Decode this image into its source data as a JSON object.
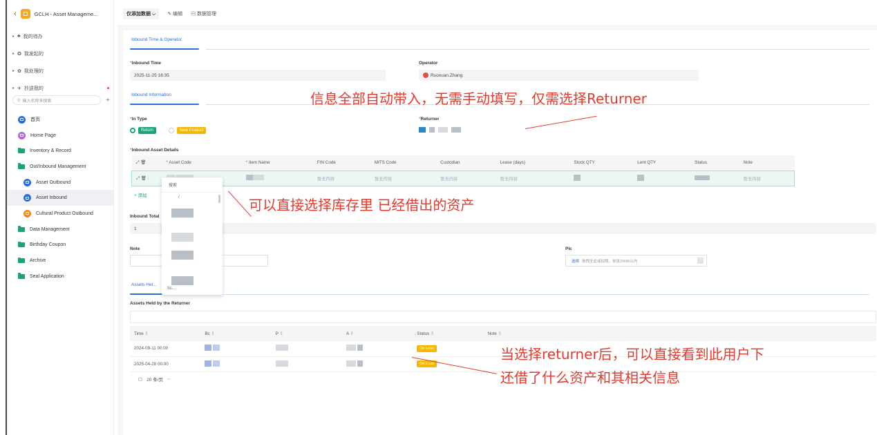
{
  "app": {
    "title": "GCLH - Asset Manageme..."
  },
  "nav_top": [
    {
      "label": "我的待办",
      "icon": "bell-icon",
      "glyph": "♣"
    },
    {
      "label": "我发起的",
      "icon": "gear-icon",
      "glyph": "✪"
    },
    {
      "label": "我处理的",
      "icon": "handle-icon",
      "glyph": "✿"
    },
    {
      "label": "抄送我的",
      "icon": "send-icon",
      "glyph": "✈"
    }
  ],
  "search": {
    "placeholder": "输入名称来搜索"
  },
  "menu": [
    {
      "label": "首页",
      "type": "home",
      "sub": false,
      "color": "#2b6cd9"
    },
    {
      "label": "Home Page",
      "type": "circle",
      "sub": false,
      "color": "#b36ad7"
    },
    {
      "label": "Inventory & Record",
      "type": "folder",
      "sub": false
    },
    {
      "label": "Out/Inbound Management",
      "type": "folder",
      "sub": false
    },
    {
      "label": "Asset Outbound",
      "type": "circle",
      "sub": true,
      "color": "#2b6cd9"
    },
    {
      "label": "Asset Inbound",
      "type": "circle",
      "sub": true,
      "color": "#2b6cd9",
      "active": true
    },
    {
      "label": "Cultural Product Outbound",
      "type": "circle",
      "sub": true,
      "color": "#f08a24"
    },
    {
      "label": "Data Management",
      "type": "folder",
      "sub": false
    },
    {
      "label": "Birthday Coupon",
      "type": "folder",
      "sub": false
    },
    {
      "label": "Archive",
      "type": "folder",
      "sub": false
    },
    {
      "label": "Seal Application",
      "type": "folder",
      "sub": false
    }
  ],
  "topbar": {
    "view": "仅添加数据",
    "edit": "编辑",
    "data_manage": "数据管理"
  },
  "sections": {
    "time_operator": "Inbound Time & Operator",
    "information": "Inbound Information",
    "assets_held_tab": "Assets Hel..."
  },
  "fields": {
    "inbound_time_label": "Inbound Time",
    "inbound_time_value": "2025-11-25 16:35",
    "operator_label": "Operator",
    "operator_value": "Ruoxuan.Zhang",
    "in_type_label": "In Type",
    "in_type_options": [
      "Return",
      "New Product"
    ],
    "returner_label": "Returner",
    "details_label": "Inbound Asset Details",
    "add_label": "+ 添加",
    "inbound_total_label": "Inbound Total",
    "inbound_total_value": "1",
    "note_label": "Note",
    "pic_label": "Pic",
    "pic_select": "选择",
    "pic_hint": "拖拽至此或拍照，单张20MB以内",
    "held_label": "Assets Held by the Returner"
  },
  "details_columns": [
    "Asset Code",
    "Item Name",
    "FIN Code",
    "MITS Code",
    "Custodian",
    "Lease (days)",
    "Stock QTY",
    "Lent QTY",
    "Status",
    "Note"
  ],
  "details_placeholder": "暂无内容",
  "dropdown": {
    "search": "搜索",
    "first": "/",
    "footer": "Sc..."
  },
  "held_columns": [
    "Time",
    "Bc",
    "P",
    "A",
    "Status",
    "Note"
  ],
  "held_rows": [
    {
      "time": "2024-09-11 00:00",
      "status": "On Loan"
    },
    {
      "time": "2025-04-28 00:00",
      "status": "On Loan"
    }
  ],
  "pager": {
    "page_size": "20 条/页"
  },
  "annotations": {
    "a1": "信息全部自动带入，无需手动填写，仅需选择Returner",
    "a2": "可以直接选择库存里 已经借出的资产",
    "a3_line1": "当选择returner后，可以直接看到此用户下",
    "a3_line2": "还借了什么资产和其相关信息"
  },
  "colors": {
    "accent": "#2b6cd9",
    "green": "#1aa37a",
    "annotation": "#e03b2f",
    "on_loan": "#f5b800"
  }
}
